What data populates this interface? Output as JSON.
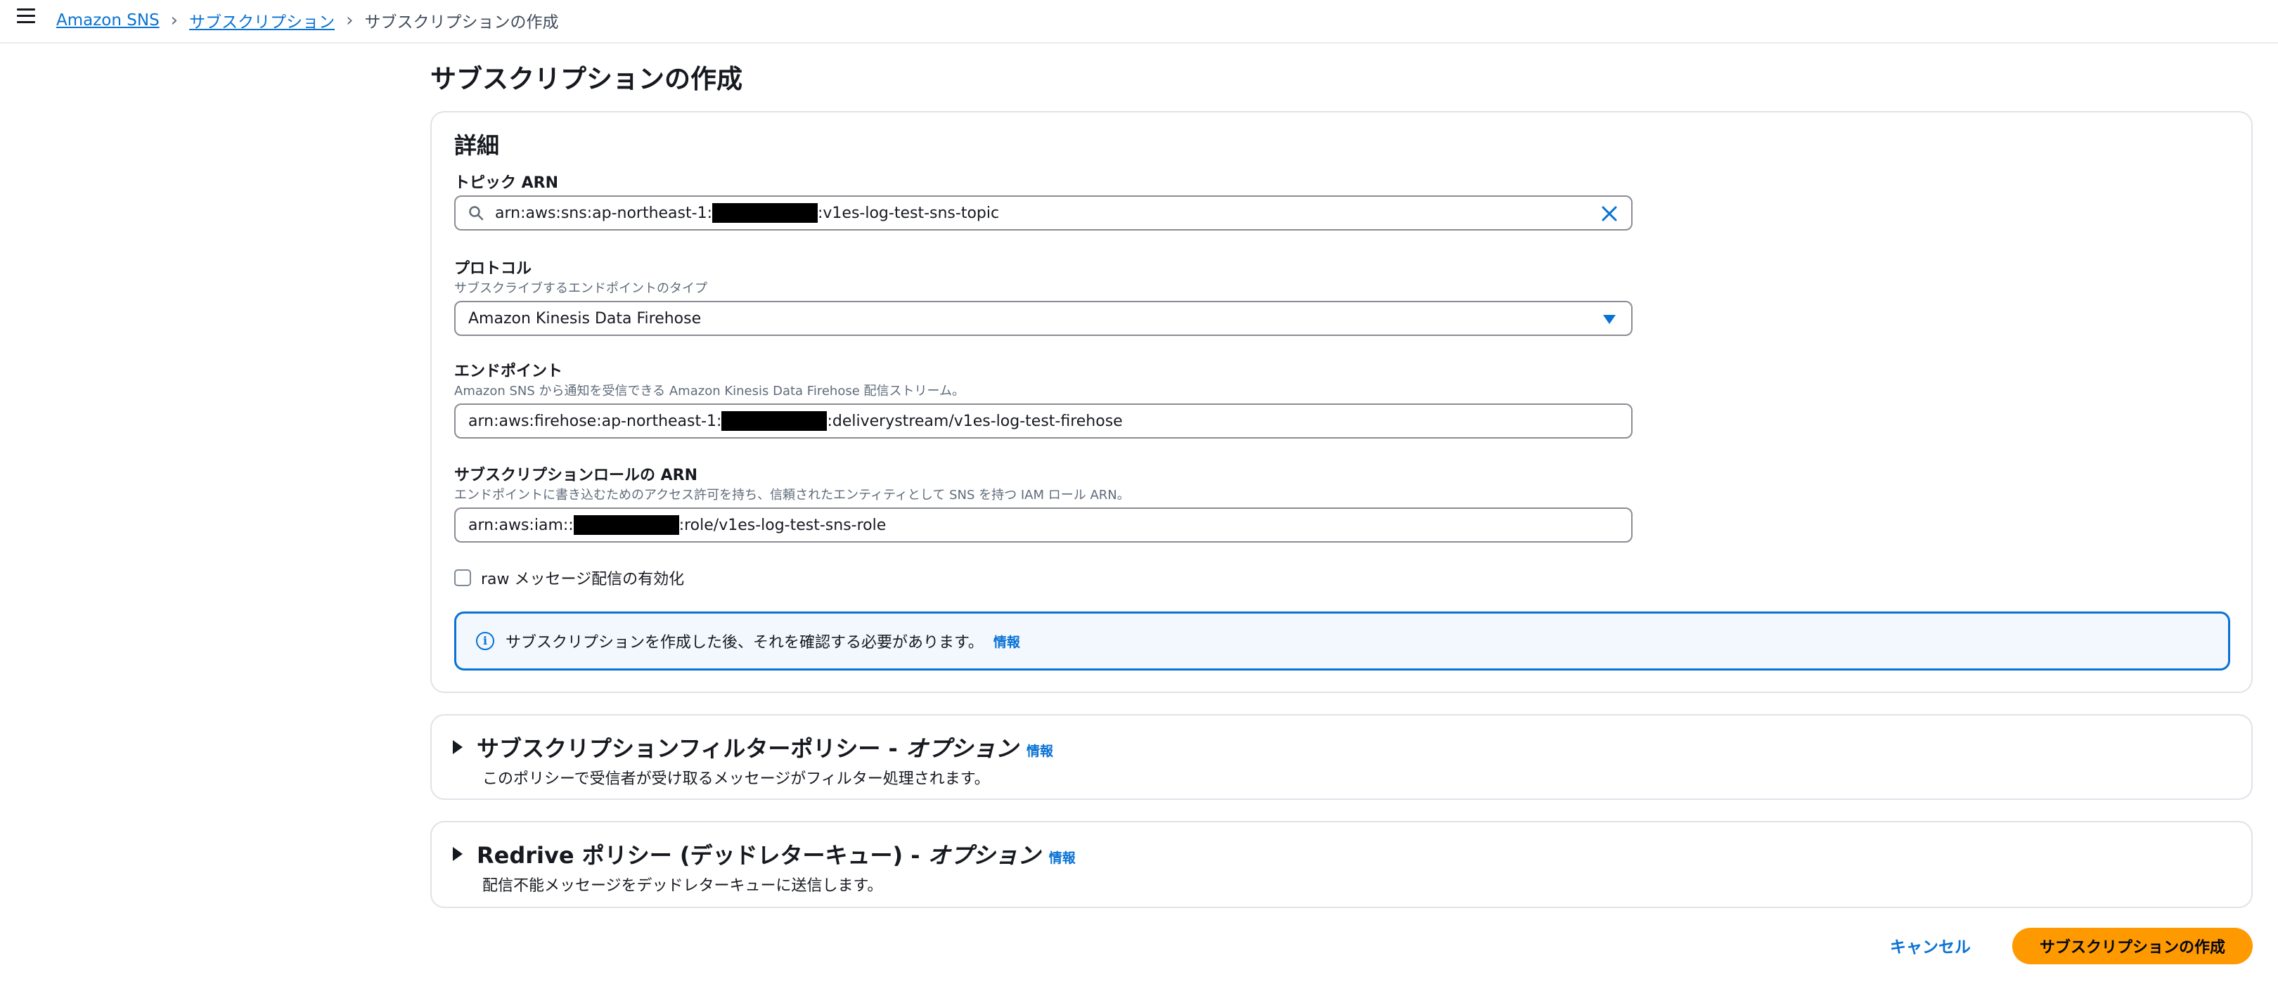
{
  "breadcrumb": {
    "items": [
      "Amazon SNS",
      "サブスクリプション"
    ],
    "current": "サブスクリプションの作成"
  },
  "page": {
    "title": "サブスクリプションの作成"
  },
  "details": {
    "title": "詳細",
    "topic_arn": {
      "label": "トピック ARN",
      "value_prefix": "arn:aws:sns:ap-northeast-1:",
      "value_suffix": ":v1es-log-test-sns-topic"
    },
    "protocol": {
      "label": "プロトコル",
      "description": "サブスクライブするエンドポイントのタイプ",
      "value": "Amazon Kinesis Data Firehose"
    },
    "endpoint": {
      "label": "エンドポイント",
      "description": "Amazon SNS から通知を受信できる Amazon Kinesis Data Firehose 配信ストリーム。",
      "value_prefix": "arn:aws:firehose:ap-northeast-1:",
      "value_suffix": ":deliverystream/v1es-log-test-firehose"
    },
    "role_arn": {
      "label": "サブスクリプションロールの ARN",
      "description": "エンドポイントに書き込むためのアクセス許可を持ち、信頼されたエンティティとして SNS を持つ IAM ロール ARN。",
      "value_prefix": "arn:aws:iam::",
      "value_suffix": ":role/v1es-log-test-sns-role"
    },
    "raw_delivery": {
      "label": "raw メッセージ配信の有効化",
      "checked": false
    },
    "alert": {
      "text": "サブスクリプションを作成した後、それを確認する必要があります。",
      "link": "情報"
    }
  },
  "filter_policy": {
    "title": "サブスクリプションフィルターポリシー - ",
    "title_optional": "オプション",
    "info": "情報",
    "description": "このポリシーで受信者が受け取るメッセージがフィルター処理されます。"
  },
  "redrive_policy": {
    "title": "Redrive ポリシー (デッドレターキュー) - ",
    "title_optional": "オプション",
    "info": "情報",
    "description": "配信不能メッセージをデッドレターキューに送信します。"
  },
  "actions": {
    "cancel": "キャンセル",
    "create": "サブスクリプションの作成"
  },
  "colors": {
    "accent": "#0972d3",
    "primary_button": "#ff9900"
  },
  "icons": [
    "menu-icon",
    "chevron-right-icon",
    "search-icon",
    "clear-icon",
    "caret-down-icon",
    "info-icon",
    "expand-triangle-icon"
  ]
}
